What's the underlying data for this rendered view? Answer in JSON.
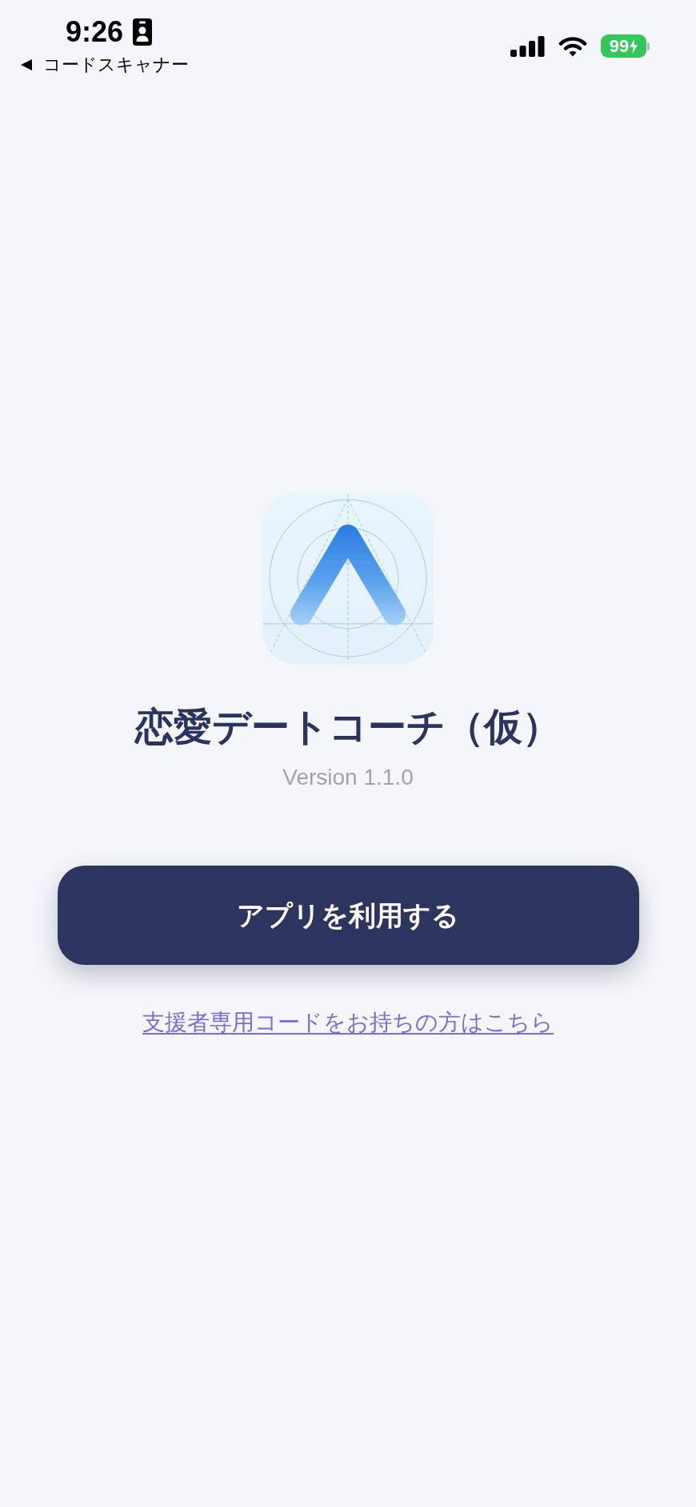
{
  "status_bar": {
    "time": "9:26",
    "back_label": "コードスキャナー",
    "battery": "99"
  },
  "app": {
    "title": "恋愛デートコーチ（仮）",
    "version": "Version 1.1.0"
  },
  "primary_button": {
    "label": "アプリを利用する"
  },
  "supporter_link": {
    "label": "支援者専用コードをお持ちの方はこちら"
  }
}
